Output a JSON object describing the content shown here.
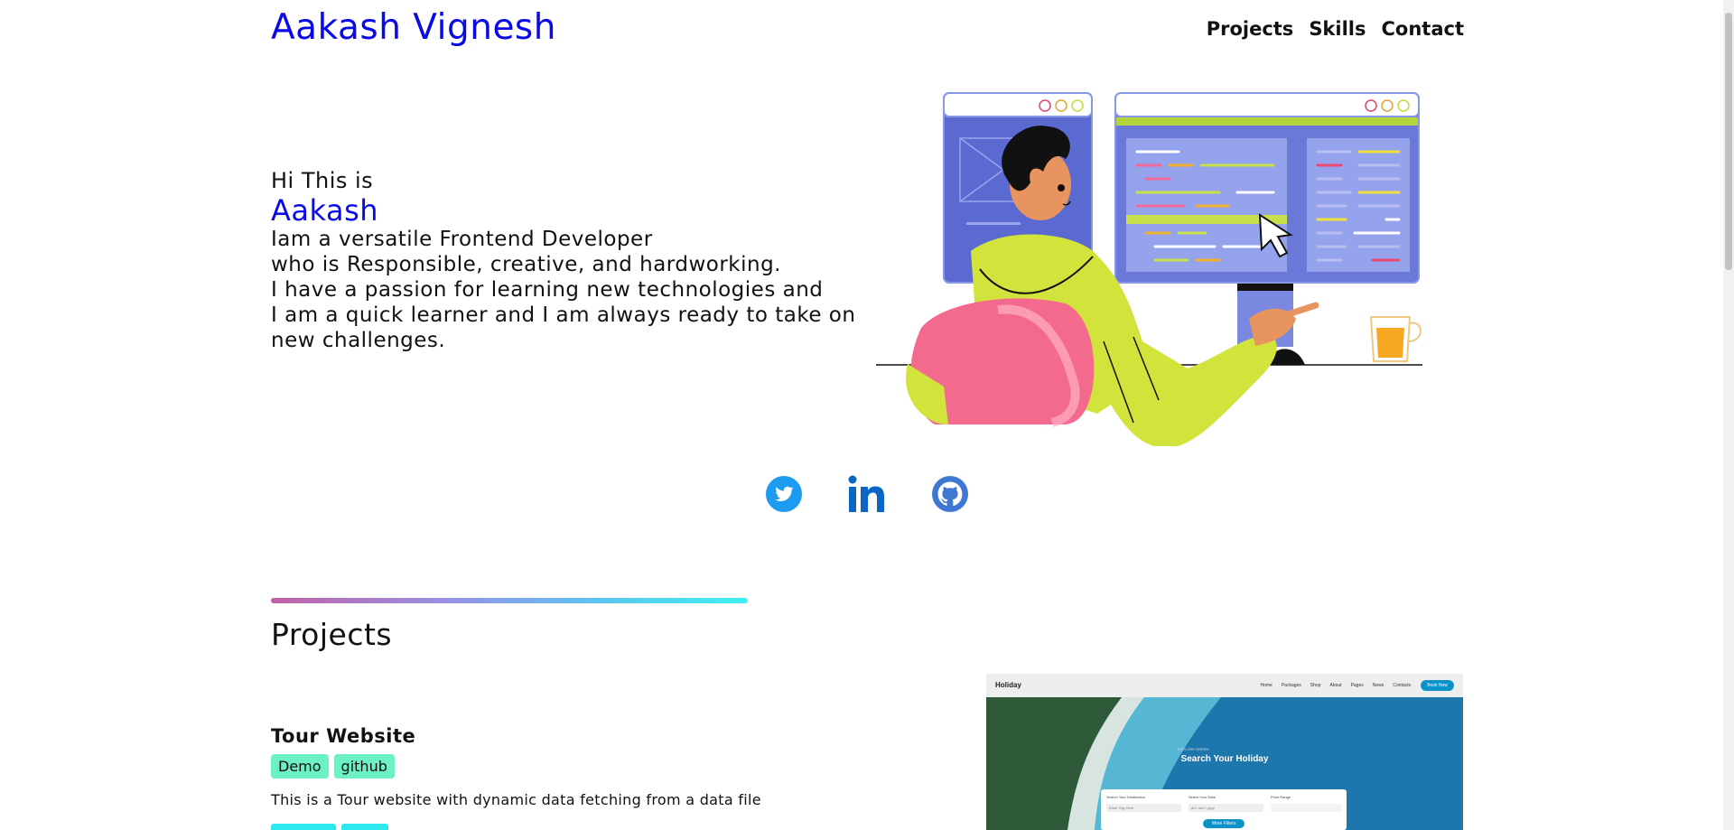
{
  "header": {
    "brand": "Aakash Vignesh",
    "nav": [
      "Projects",
      "Skills",
      "Contact"
    ]
  },
  "hero": {
    "greeting": "Hi This is",
    "name": "Aakash",
    "lines": [
      "Iam a versatile Frontend Developer",
      "who is Responsible, creative, and hardworking.",
      "I have a passion for learning new technologies and",
      "I am a quick learner and I am always ready to take on",
      "new challenges."
    ]
  },
  "social": {
    "icons": [
      "twitter-icon",
      "linkedin-icon",
      "github-icon"
    ]
  },
  "projects": {
    "section_title": "Projects",
    "items": [
      {
        "title": "Tour Website",
        "tags": [
          "Demo",
          "github"
        ],
        "description": "This is a Tour website with dynamic data fetching from a data file",
        "preview": {
          "logo": "Holiday",
          "nav": [
            "Home",
            "Packages",
            "Shop",
            "About",
            "Pages",
            "News",
            "Contacts"
          ],
          "book_button": "Book Now",
          "heading": "Search Your Holiday",
          "small_label": "EXPLORE GREEN",
          "fields": [
            {
              "label": "Search Your Destination",
              "value": "Enter City Here"
            },
            {
              "label": "Select Your Date",
              "value": "dd / mm / yyyy"
            },
            {
              "label": "Price Range",
              "value": "$5000"
            }
          ],
          "filter_button": "More Filters"
        }
      }
    ]
  },
  "colors": {
    "brand_blue": "#0a0ae6",
    "tag_green": "#6cf0c6",
    "twitter_blue": "#1d9bf0",
    "linkedin_blue": "#0a66c2",
    "github_blue": "#3f78d2"
  }
}
